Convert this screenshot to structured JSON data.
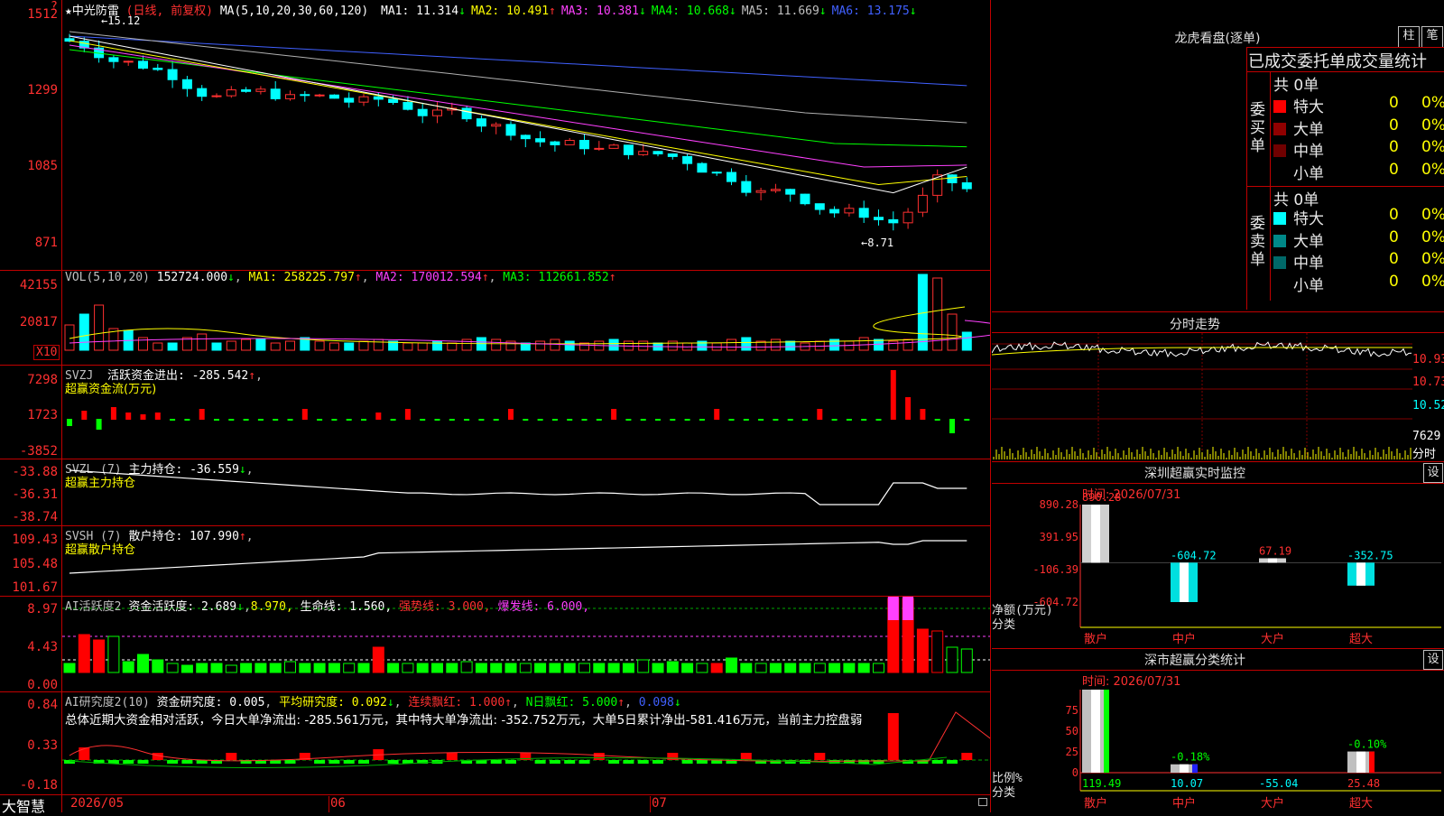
{
  "app": {
    "brand": "大智慧"
  },
  "main_chart": {
    "star": "★",
    "name": "中光防雷",
    "mode": "(日线, 前复权)",
    "ma_label": "MA(5,10,20,30,60,120)",
    "ma_values": [
      {
        "label": "MA1: 11.314",
        "arrow": "↓",
        "color": "#ffffff"
      },
      {
        "label": "MA2: 10.491",
        "arrow": "↑",
        "color": "#ffff00"
      },
      {
        "label": "MA3: 10.381",
        "arrow": "↓",
        "color": "#ff40ff"
      },
      {
        "label": "MA4: 10.668",
        "arrow": "↓",
        "color": "#00ff00"
      },
      {
        "label": "MA5: 11.669",
        "arrow": "↓",
        "color": "#c0c0c0"
      },
      {
        "label": "MA6: 13.175",
        "arrow": "↓",
        "color": "#4060ff"
      }
    ],
    "y_labels": [
      "1512",
      "1299",
      "1085",
      "871"
    ],
    "high_label": "15.12",
    "low_label": "←8.71"
  },
  "vol_panel": {
    "title": "VOL(5,10,20)",
    "value": "152724.000",
    "ma1": "MA1: 258225.797",
    "ma2": "MA2: 170012.594",
    "ma3": "MA3: 112661.852",
    "y_labels": [
      "42155",
      "20817"
    ],
    "unit": "X10"
  },
  "svzj_panel": {
    "title": "SVZJ",
    "label": "活跃资金进出: -285.542",
    "subtitle": "超赢资金流(万元)",
    "y_labels": [
      "7298",
      "1723",
      "-3852"
    ]
  },
  "svzl_panel": {
    "title": "SVZL (7)",
    "label": "主力持仓: -36.559",
    "subtitle": "超赢主力持仓",
    "y_labels": [
      "-33.88",
      "-36.31",
      "-38.74"
    ]
  },
  "svsh_panel": {
    "title": "SVSH (7)",
    "label": "散户持仓: 107.990",
    "subtitle": "超赢散户持仓",
    "y_labels": [
      "109.43",
      "105.48",
      "101.67"
    ]
  },
  "ai_active_panel": {
    "title": "AI活跃度2",
    "active": "资金活跃度: 2.689",
    "active2": "8.970,",
    "life": "生命线: 1.560,",
    "strong": "强势线: 3.000,",
    "burst": "爆发线: 6.000,",
    "y_labels": [
      "8.97",
      "4.43",
      "0.00"
    ]
  },
  "ai_research_panel": {
    "title": "AI研究度2(10)",
    "research": "资金研究度: 0.005",
    "avg": "平均研究度: 0.092",
    "red_cont": "连续飘红: 1.000",
    "n_day": "N日飘红: 5.000",
    "extra": "0.098",
    "summary": "总体近期大资金相对活跃，今日大单净流出: -285.561万元，其中特大单净流出: -352.752万元，大单5日累计净出-581.416万元，当前主力控盘弱",
    "y_labels": [
      "0.84",
      "0.33",
      "-0.18"
    ]
  },
  "x_axis": {
    "labels": [
      "2026/05",
      "06",
      "07"
    ]
  },
  "longhu": {
    "title": "龙虎看盘(逐单)",
    "btn1": "柱",
    "btn2": "笔",
    "subtitle": "已成交委托单成交量统计",
    "buy_side": "委买单",
    "sell_side": "委卖单",
    "buy_total": "共 0单",
    "sell_total": "共 0单",
    "buy_rows": [
      {
        "label": "特大",
        "count": "0",
        "pct": "0%",
        "color": "#ff0000"
      },
      {
        "label": "大单",
        "count": "0",
        "pct": "0%",
        "color": "#900000"
      },
      {
        "label": "中单",
        "count": "0",
        "pct": "0%",
        "color": "#700000"
      },
      {
        "label": "小单",
        "count": "0",
        "pct": "0%",
        "color": ""
      }
    ],
    "sell_rows": [
      {
        "label": "特大",
        "count": "0",
        "pct": "0%",
        "color": "#00ffff"
      },
      {
        "label": "大单",
        "count": "0",
        "pct": "0%",
        "color": "#008888"
      },
      {
        "label": "中单",
        "count": "0",
        "pct": "0%",
        "color": "#006868"
      },
      {
        "label": "小单",
        "count": "0",
        "pct": "0%",
        "color": ""
      }
    ]
  },
  "intraday": {
    "title": "分时走势",
    "y_labels": [
      "10.93",
      "10.73",
      "10.52"
    ],
    "vol_label": "7629",
    "vol_unit": "分时"
  },
  "sz_monitor": {
    "title": "深圳超赢实时监控",
    "btn": "设",
    "time": "时间: 2026/07/31",
    "y_labels": [
      "890.28",
      "391.95",
      "-106.39",
      "-604.72"
    ],
    "y_unit": "净额(万元)",
    "x_unit": "分类",
    "chart_data": {
      "type": "bar",
      "categories": [
        "散户",
        "中户",
        "大户",
        "超大"
      ],
      "values": [
        890.28,
        -604.72,
        67.19,
        -352.75
      ],
      "value_labels": [
        "890.28",
        "-604.72",
        "67.19",
        "-352.75"
      ],
      "ylabel": "净额(万元)",
      "xlabel": "分类",
      "ylim": [
        -604.72,
        890.28
      ]
    }
  },
  "sz_classify": {
    "title": "深市超赢分类统计",
    "btn": "设",
    "time": "时间: 2026/07/31",
    "y_labels": [
      "75",
      "50",
      "25",
      "0"
    ],
    "y_unit": "比例%",
    "x_unit": "分类",
    "chart_data": {
      "type": "bar",
      "categories": [
        "散户",
        "中户",
        "大户",
        "超大"
      ],
      "values": [
        119.49,
        10.07,
        -55.04,
        25.48
      ],
      "value_labels": [
        "119.49",
        "10.07",
        "-55.04",
        "25.48"
      ],
      "pct_labels": [
        "",
        "-0.18%",
        "",
        "-0.10%"
      ],
      "ylabel": "比例%",
      "xlabel": "分类",
      "ylim": [
        0,
        100
      ]
    }
  }
}
